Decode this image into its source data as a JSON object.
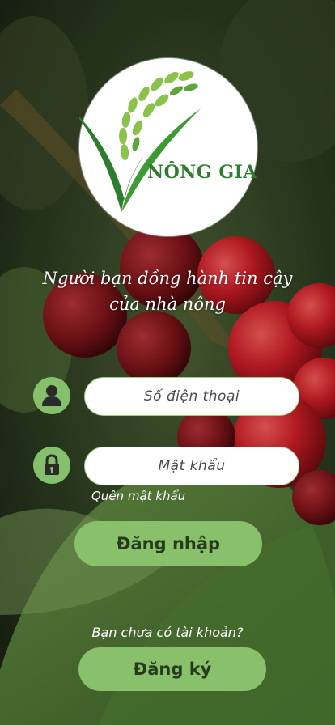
{
  "logo": {
    "brand_name": "NÔNG GIA",
    "icon": "rice-stalk-logo-icon"
  },
  "tagline": {
    "line1": "Người bạn đồng hành tin cậy",
    "line2": "của nhà nông"
  },
  "form": {
    "phone": {
      "placeholder": "Số điện thoại",
      "icon": "user-icon"
    },
    "password": {
      "placeholder": "Mật khẩu",
      "icon": "lock-icon"
    },
    "forgot_password": "Quên mật khẩu",
    "login_label": "Đăng nhập"
  },
  "register": {
    "prompt": "Bạn chưa có tài khoản?",
    "button_label": "Đăng ký"
  },
  "colors": {
    "accent": "#88c06b",
    "brand_green": "#2e7d2e",
    "text_dark": "#263a1c"
  }
}
